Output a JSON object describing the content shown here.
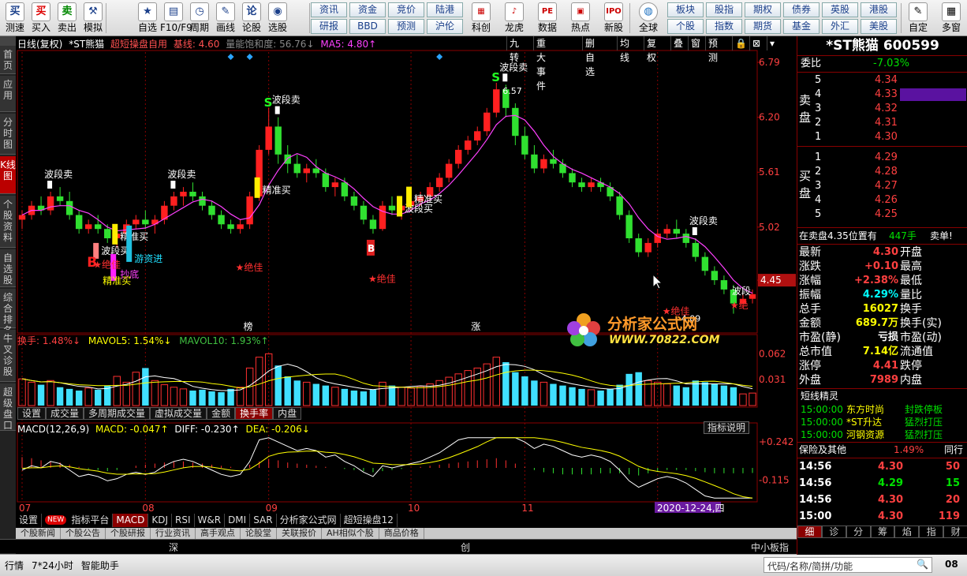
{
  "toolbar": {
    "buttons": [
      {
        "icon": "买",
        "label": "测速"
      },
      {
        "icon": "买",
        "label": "买入"
      },
      {
        "icon": "卖",
        "label": "卖出"
      },
      {
        "icon": "⚒",
        "label": "模拟"
      },
      {
        "icon": "★",
        "label": "自选"
      },
      {
        "icon": "▤",
        "label": "F10/F9"
      },
      {
        "icon": "◷",
        "label": "周期"
      },
      {
        "icon": "✎",
        "label": "画线"
      },
      {
        "icon": "论",
        "label": "论股"
      },
      {
        "icon": "◉",
        "label": "选股"
      }
    ],
    "grid_buttons": [
      [
        "资讯",
        "资金",
        "竞价",
        "陆港"
      ],
      [
        "研报",
        "BBD",
        "预测",
        "沪伦"
      ]
    ],
    "icon_buttons": [
      {
        "icon": "▦",
        "label": "科创"
      },
      {
        "icon": "♪",
        "label": "龙虎"
      },
      {
        "icon": "PE",
        "label": "数据"
      },
      {
        "icon": "▣",
        "label": "热点"
      },
      {
        "icon": "IPO",
        "label": "新股"
      }
    ],
    "globe_label": "全球",
    "grid_buttons2": [
      [
        "板块",
        "股指",
        "期权",
        "债券",
        "英股",
        "港股"
      ],
      [
        "个股",
        "指数",
        "期货",
        "基金",
        "外汇",
        "美股"
      ]
    ],
    "custom_label": "自定",
    "more_label": "多窗"
  },
  "left_tabs": [
    "首页",
    "应用",
    "分时图",
    "K线图",
    "个股资料",
    "自选股",
    "综合排名",
    "牛叉诊股",
    "超级盘口"
  ],
  "chart_header": {
    "period": "日线(复权)",
    "stock": "*ST熊猫",
    "indicator": "超短操盘自用",
    "base_line": "基线: 4.60",
    "volume_sat": "量能饱和度: 56.76↓",
    "ma5": "MA5: 4.80↑"
  },
  "chart_toolbar": [
    "九转",
    "重大事件",
    "删自选",
    "均线",
    "复权",
    "叠",
    "窗",
    "预测",
    "🔒",
    "⊠",
    "▾"
  ],
  "price_axis": [
    "6.79",
    "6.20",
    "5.61",
    "5.02",
    "4.45"
  ],
  "price_axis_extra": "4.45",
  "chart_labels": {
    "bands": [
      "波段卖",
      "波段卖",
      "波段卖",
      "波段卖",
      "波段卖"
    ],
    "precise_buy": "精准买",
    "precise_buy2": "精准买",
    "precise_buy3": "精准买",
    "precise_buy4": "精准买",
    "band_buy": "波段买",
    "band_buy2": "波段买",
    "hot_money": "游资进",
    "bottom": "抄底",
    "best": [
      "★绝佳",
      "★绝佳",
      "★绝佳",
      "★绝佳"
    ],
    "peak_price": "6.57",
    "low_price": "4.09",
    "bang": "榜",
    "zhang": "涨",
    "band_label_r": "波段",
    "jue_label_r": "★绝"
  },
  "watermark": {
    "title": "分析家公式网",
    "url": "WWW.70822.COM"
  },
  "turnover_header": {
    "label": "换手: 1.48%↓",
    "mavol5": "MAVOL5: 1.54%↓",
    "mavol10": "MAVOL10: 1.93%↑"
  },
  "turnover_axis": [
    "0.062",
    "0.031"
  ],
  "sub_tabs": [
    "设置",
    "成交量",
    "多周期成交量",
    "虚拟成交量",
    "金额",
    "换手率",
    "内盘"
  ],
  "sub_tabs_active": 5,
  "macd_header": {
    "label": "MACD(12,26,9)",
    "macd": "MACD: -0.047↑",
    "diff": "DIFF: -0.230↑",
    "dea": "DEA: -0.206↓"
  },
  "macd_axis": [
    "+0.242",
    "-0.115"
  ],
  "indicator_btn": "指标说明",
  "month_labels": [
    "07",
    "08",
    "09",
    "10",
    "11",
    "12"
  ],
  "date_badge": "2020-12-24,四",
  "bottom_tabs": [
    "设置",
    "指标平台",
    "MACD",
    "KDJ",
    "RSI",
    "W&R",
    "DMI",
    "SAR",
    "分析家公式网",
    "超短操盘12"
  ],
  "bottom_tabs_new": "NEW",
  "bottom_tabs_active": 2,
  "news_tabs": [
    "个股新闻",
    "个股公告",
    "个股研报",
    "行业资讯",
    "高手观点",
    "论股堂",
    "关联报价",
    "AH相似个股",
    "商品价格"
  ],
  "market_bar": {
    "shen": "深",
    "chuang": "创",
    "smb": "中小板指"
  },
  "status": {
    "items": [
      "行情",
      "7*24小时",
      "智能助手"
    ],
    "search_placeholder": "代码/名称/简拼/功能",
    "right": "08"
  },
  "right_panel": {
    "title": "*ST熊猫 600599",
    "weibi_label": "委比",
    "weibi_value": "-7.03%",
    "sell_label": "卖盘",
    "buy_label": "买盘",
    "sells": [
      {
        "n": "5",
        "price": "4.34",
        "vol": ""
      },
      {
        "n": "4",
        "price": "4.33",
        "vol": ""
      },
      {
        "n": "3",
        "price": "4.32",
        "vol": ""
      },
      {
        "n": "2",
        "price": "4.31",
        "vol": ""
      },
      {
        "n": "1",
        "price": "4.30",
        "vol": ""
      }
    ],
    "buys": [
      {
        "n": "1",
        "price": "4.29",
        "vol": ""
      },
      {
        "n": "2",
        "price": "4.28",
        "vol": ""
      },
      {
        "n": "3",
        "price": "4.27",
        "vol": ""
      },
      {
        "n": "4",
        "price": "4.26",
        "vol": ""
      },
      {
        "n": "5",
        "price": "4.25",
        "vol": ""
      }
    ],
    "notice": "在卖盘4.35位置有",
    "notice_vol": "447手",
    "notice_tag": "卖单!",
    "stats": [
      {
        "l1": "最新",
        "v1": "4.30",
        "l2": "开盘",
        "c": "red"
      },
      {
        "l1": "涨跌",
        "v1": "+0.10",
        "l2": "最高",
        "c": "red"
      },
      {
        "l1": "涨幅",
        "v1": "+2.38%",
        "l2": "最低",
        "c": "red"
      },
      {
        "l1": "振幅",
        "v1": "4.29%",
        "l2": "量比",
        "c": "cyan"
      },
      {
        "l1": "总手",
        "v1": "16027",
        "l2": "换手",
        "c": "yellow"
      },
      {
        "l1": "金额",
        "v1": "689.7万",
        "l2": "换手(实)",
        "c": "yellow"
      },
      {
        "l1": "市盈(静)",
        "v1": "亏损",
        "l2": "市盈(动)",
        "c": "white"
      },
      {
        "l1": "总市值",
        "v1": "7.14亿",
        "l2": "流通值",
        "c": "yellow"
      },
      {
        "l1": "涨停",
        "v1": "4.41",
        "l2": "跌停",
        "c": "red"
      },
      {
        "l1": "外盘",
        "v1": "7989",
        "l2": "内盘",
        "c": "red"
      }
    ],
    "short_title": "短线精灵",
    "short_rows": [
      {
        "t": "15:00:00",
        "name": "东方时尚",
        "event": "封跌停板"
      },
      {
        "t": "15:00:00",
        "name": "*ST升达",
        "event": "猛烈打压"
      },
      {
        "t": "15:00:00",
        "name": "河钢资源",
        "event": "猛烈打压"
      }
    ],
    "insurance_label": "保险及其他",
    "insurance_value": "1.49%",
    "insurance_more": "同行",
    "ticks": [
      {
        "t": "14:56",
        "p": "4.30",
        "v": "50",
        "c": "red"
      },
      {
        "t": "14:56",
        "p": "4.29",
        "v": "15",
        "c": "green"
      },
      {
        "t": "14:56",
        "p": "4.30",
        "v": "20",
        "c": "red"
      },
      {
        "t": "15:00",
        "p": "4.30",
        "v": "119",
        "c": "red"
      }
    ],
    "bottom_tabs": [
      "细",
      "诊",
      "分",
      "筹",
      "焰",
      "指",
      "财"
    ]
  },
  "chart_data": {
    "type": "candlestick",
    "ylim": [
      3.9,
      6.9
    ],
    "candles": [
      [
        5.1,
        5.2,
        5.0,
        5.15
      ],
      [
        5.15,
        5.3,
        5.1,
        5.25
      ],
      [
        5.25,
        5.35,
        5.15,
        5.2
      ],
      [
        5.2,
        5.4,
        5.15,
        5.35
      ],
      [
        5.35,
        5.45,
        5.25,
        5.3
      ],
      [
        5.3,
        5.4,
        5.1,
        5.15
      ],
      [
        5.15,
        5.2,
        4.95,
        5.0
      ],
      [
        5.0,
        5.1,
        4.95,
        5.05
      ],
      [
        5.05,
        5.15,
        4.95,
        5.0
      ],
      [
        5.0,
        5.05,
        4.85,
        4.9
      ],
      [
        4.9,
        5.0,
        4.8,
        4.95
      ],
      [
        4.95,
        5.1,
        4.9,
        5.05
      ],
      [
        5.05,
        5.15,
        5.0,
        5.1
      ],
      [
        5.1,
        5.2,
        5.0,
        5.05
      ],
      [
        5.05,
        5.15,
        4.95,
        5.1
      ],
      [
        5.1,
        5.3,
        5.05,
        5.25
      ],
      [
        5.25,
        5.4,
        5.2,
        5.35
      ],
      [
        5.35,
        5.45,
        5.25,
        5.4
      ],
      [
        5.4,
        5.5,
        5.3,
        5.35
      ],
      [
        5.35,
        5.4,
        5.2,
        5.25
      ],
      [
        5.25,
        5.3,
        5.1,
        5.15
      ],
      [
        5.15,
        5.2,
        5.0,
        5.05
      ],
      [
        5.05,
        5.1,
        4.95,
        5.0
      ],
      [
        5.0,
        5.1,
        4.95,
        5.05
      ],
      [
        5.05,
        5.4,
        5.0,
        5.35
      ],
      [
        5.35,
        5.9,
        5.3,
        5.85
      ],
      [
        5.85,
        6.3,
        5.8,
        6.1
      ],
      [
        6.1,
        6.2,
        5.7,
        5.8
      ],
      [
        5.8,
        5.9,
        5.6,
        5.7
      ],
      [
        5.7,
        5.8,
        5.55,
        5.6
      ],
      [
        5.6,
        5.7,
        5.5,
        5.65
      ],
      [
        5.65,
        5.75,
        5.55,
        5.6
      ],
      [
        5.6,
        5.65,
        5.4,
        5.45
      ],
      [
        5.45,
        5.55,
        5.35,
        5.5
      ],
      [
        5.5,
        5.55,
        5.3,
        5.35
      ],
      [
        5.35,
        5.4,
        5.2,
        5.25
      ],
      [
        5.25,
        5.3,
        5.05,
        5.1
      ],
      [
        5.1,
        5.15,
        4.95,
        5.0
      ],
      [
        5.0,
        5.3,
        4.98,
        5.25
      ],
      [
        5.25,
        5.35,
        5.15,
        5.2
      ],
      [
        5.2,
        5.3,
        5.1,
        5.25
      ],
      [
        5.25,
        5.35,
        5.2,
        5.3
      ],
      [
        5.3,
        5.4,
        5.25,
        5.35
      ],
      [
        5.35,
        5.5,
        5.3,
        5.45
      ],
      [
        5.45,
        5.6,
        5.4,
        5.55
      ],
      [
        5.55,
        5.75,
        5.5,
        5.7
      ],
      [
        5.7,
        5.9,
        5.65,
        5.85
      ],
      [
        5.85,
        6.0,
        5.8,
        5.95
      ],
      [
        5.95,
        6.1,
        5.9,
        6.05
      ],
      [
        6.05,
        6.3,
        6.0,
        6.25
      ],
      [
        6.25,
        6.57,
        6.2,
        6.5
      ],
      [
        6.5,
        6.55,
        6.2,
        6.3
      ],
      [
        6.3,
        6.35,
        5.9,
        6.0
      ],
      [
        6.0,
        6.1,
        5.75,
        5.8
      ],
      [
        5.8,
        5.9,
        5.6,
        5.65
      ],
      [
        5.65,
        5.8,
        5.6,
        5.75
      ],
      [
        5.75,
        5.85,
        5.65,
        5.7
      ],
      [
        5.7,
        5.75,
        5.55,
        5.6
      ],
      [
        5.6,
        5.65,
        5.45,
        5.5
      ],
      [
        5.5,
        5.55,
        5.4,
        5.45
      ],
      [
        5.45,
        5.55,
        5.4,
        5.5
      ],
      [
        5.5,
        5.55,
        5.4,
        5.45
      ],
      [
        5.45,
        5.5,
        5.3,
        5.35
      ],
      [
        5.35,
        5.4,
        5.1,
        5.15
      ],
      [
        5.15,
        5.2,
        4.85,
        4.9
      ],
      [
        4.9,
        4.95,
        4.7,
        4.75
      ],
      [
        4.75,
        4.9,
        4.7,
        4.85
      ],
      [
        4.85,
        5.0,
        4.8,
        4.95
      ],
      [
        4.95,
        5.05,
        4.9,
        5.0
      ],
      [
        5.0,
        5.1,
        4.9,
        4.95
      ],
      [
        4.95,
        5.0,
        4.8,
        4.85
      ],
      [
        4.85,
        4.9,
        4.65,
        4.7
      ],
      [
        4.7,
        4.75,
        4.5,
        4.55
      ],
      [
        4.55,
        4.6,
        4.4,
        4.45
      ],
      [
        4.45,
        4.5,
        4.3,
        4.35
      ],
      [
        4.35,
        4.4,
        4.09,
        4.2
      ],
      [
        4.2,
        4.3,
        4.15,
        4.25
      ],
      [
        4.25,
        4.35,
        4.2,
        4.3
      ]
    ],
    "turnover": [
      0.032,
      0.028,
      0.025,
      0.03,
      0.022,
      0.02,
      0.018,
      0.021,
      0.019,
      0.024,
      0.035,
      0.028,
      0.04,
      0.045,
      0.03,
      0.025,
      0.022,
      0.02,
      0.018,
      0.019,
      0.017,
      0.016,
      0.02,
      0.022,
      0.045,
      0.058,
      0.062,
      0.048,
      0.035,
      0.03,
      0.028,
      0.026,
      0.024,
      0.022,
      0.02,
      0.018,
      0.017,
      0.019,
      0.028,
      0.024,
      0.022,
      0.021,
      0.023,
      0.026,
      0.03,
      0.034,
      0.038,
      0.042,
      0.045,
      0.05,
      0.058,
      0.052,
      0.04,
      0.035,
      0.03,
      0.028,
      0.026,
      0.024,
      0.022,
      0.02,
      0.019,
      0.018,
      0.02,
      0.025,
      0.038,
      0.04,
      0.03,
      0.028,
      0.026,
      0.024,
      0.022,
      0.03,
      0.028,
      0.026,
      0.024,
      0.022,
      0.014,
      0.015
    ],
    "macd_hist": [
      0.1,
      0.09,
      0.07,
      0.06,
      0.05,
      0.03,
      0.01,
      -0.01,
      -0.02,
      -0.03,
      -0.02,
      0.0,
      0.02,
      0.03,
      0.04,
      0.05,
      0.06,
      0.06,
      0.05,
      0.04,
      0.03,
      0.02,
      0.01,
      0.0,
      0.03,
      0.06,
      0.08,
      0.07,
      0.05,
      0.04,
      0.03,
      0.02,
      0.01,
      0.0,
      -0.01,
      -0.02,
      -0.03,
      -0.04,
      -0.03,
      -0.02,
      -0.01,
      0.0,
      0.01,
      0.02,
      0.03,
      0.04,
      0.05,
      0.06,
      0.07,
      0.08,
      0.09,
      0.07,
      0.04,
      0.01,
      -0.02,
      -0.04,
      -0.05,
      -0.06,
      -0.06,
      -0.06,
      -0.06,
      -0.05,
      -0.05,
      -0.05,
      -0.06,
      -0.07,
      -0.05,
      -0.03,
      -0.02,
      -0.02,
      -0.02,
      -0.03,
      -0.04,
      -0.05,
      -0.05,
      -0.05,
      -0.05,
      -0.047
    ],
    "ylim_macd": [
      -0.3,
      0.3
    ]
  }
}
